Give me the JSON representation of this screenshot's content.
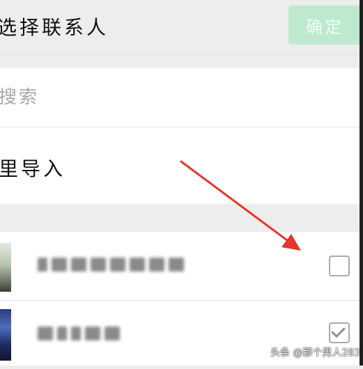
{
  "header": {
    "title": "选择联系人",
    "confirm_label": "确定"
  },
  "search": {
    "placeholder": "搜索",
    "value": ""
  },
  "import": {
    "label": "里导入"
  },
  "contacts": [
    {
      "name_redacted": true,
      "checked": false
    },
    {
      "name_redacted": true,
      "checked": true
    }
  ],
  "overlay": {
    "arrow_color": "#e8352a"
  },
  "watermark": {
    "text": "头条 @那个男人283"
  },
  "colors": {
    "accent": "#bfe9cf",
    "background": "#ededed"
  }
}
